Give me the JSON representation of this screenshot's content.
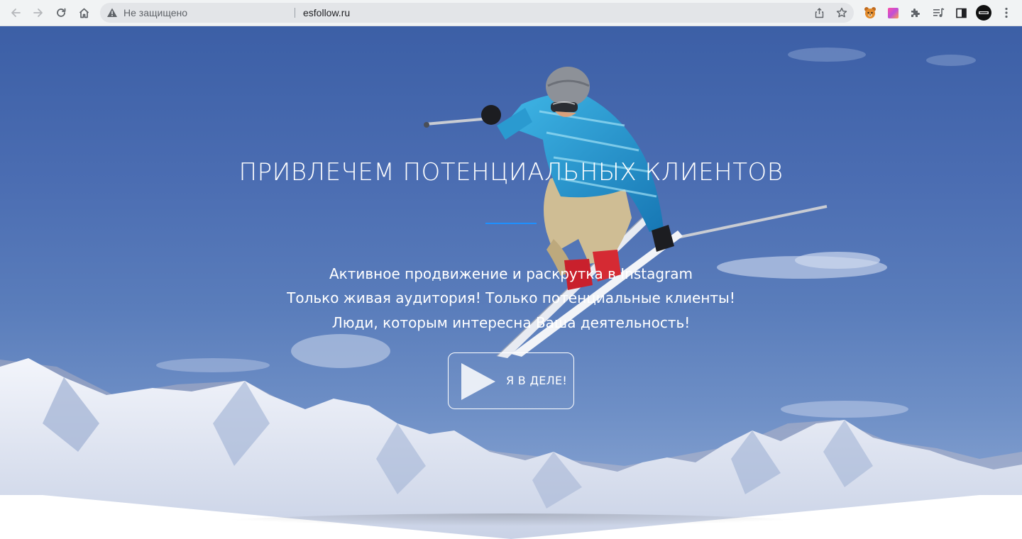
{
  "browser": {
    "security_label": "Не защищено",
    "url": "esfollow.ru"
  },
  "hero": {
    "title": "ПРИВЛЕЧЕМ ПОТЕНЦИАЛЬНЫХ КЛИЕНТОВ",
    "subtitle_lines": [
      "Активное продвижение и раскрутка в Instagram",
      "Только живая аудитория! Только потенциальные клиенты!",
      "Люди, которым интересна Ваша деятельность!"
    ],
    "cta_label": "Я В ДЕЛЕ!",
    "accent_color": "#1e90ff"
  },
  "icons": {
    "back": "back-arrow-icon",
    "forward": "forward-arrow-icon",
    "reload": "reload-icon",
    "home": "home-icon",
    "warning": "warning-triangle-icon",
    "share": "share-icon",
    "bookmark": "star-icon",
    "extensions": [
      "bear-extension-icon",
      "gradient-extension-icon",
      "puzzle-icon",
      "media-icon",
      "sidepanel-icon",
      "profile-avatar-icon",
      "kebab-menu-icon"
    ]
  }
}
